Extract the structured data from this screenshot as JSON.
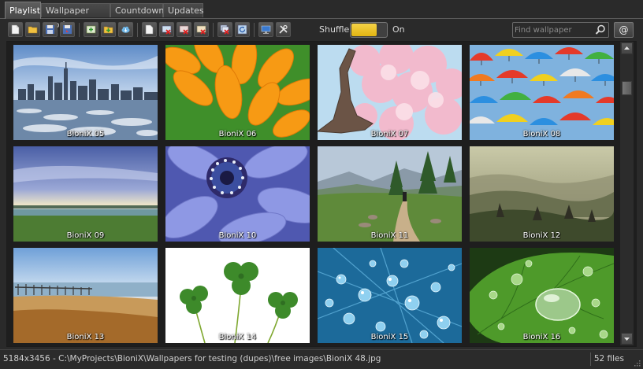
{
  "tabs": [
    {
      "label": "Playlist",
      "active": true
    },
    {
      "label": "Wallpaper mode",
      "active": false
    },
    {
      "label": "Countdown",
      "active": false
    },
    {
      "label": "Updates",
      "active": false
    }
  ],
  "toolbar": {
    "shuffle_label": "Shuffle",
    "shuffle_state": "On",
    "search_placeholder": "Find wallpaper",
    "at_button": "@",
    "accent_color": "#f0c42c"
  },
  "thumbnails": [
    {
      "caption": "BioniX 05",
      "scene": "city-skyline"
    },
    {
      "caption": "BioniX 06",
      "scene": "orange-petals"
    },
    {
      "caption": "BioniX 07",
      "scene": "cherry-blossom"
    },
    {
      "caption": "BioniX 08",
      "scene": "umbrellas"
    },
    {
      "caption": "BioniX 09",
      "scene": "lake-sunset"
    },
    {
      "caption": "BioniX 10",
      "scene": "blue-flower"
    },
    {
      "caption": "BioniX 11",
      "scene": "mountain-path"
    },
    {
      "caption": "BioniX 12",
      "scene": "misty-hills"
    },
    {
      "caption": "BioniX 13",
      "scene": "beach-pier"
    },
    {
      "caption": "BioniX 14",
      "scene": "shamrocks"
    },
    {
      "caption": "BioniX 15",
      "scene": "water-drops-blue"
    },
    {
      "caption": "BioniX 16",
      "scene": "water-drop-leaf"
    }
  ],
  "status": {
    "path": "5184x3456 - C:\\MyProjects\\BioniX\\Wallpapers for testing (dupes)\\free images\\BioniX 48.jpg",
    "count": "52 files"
  }
}
